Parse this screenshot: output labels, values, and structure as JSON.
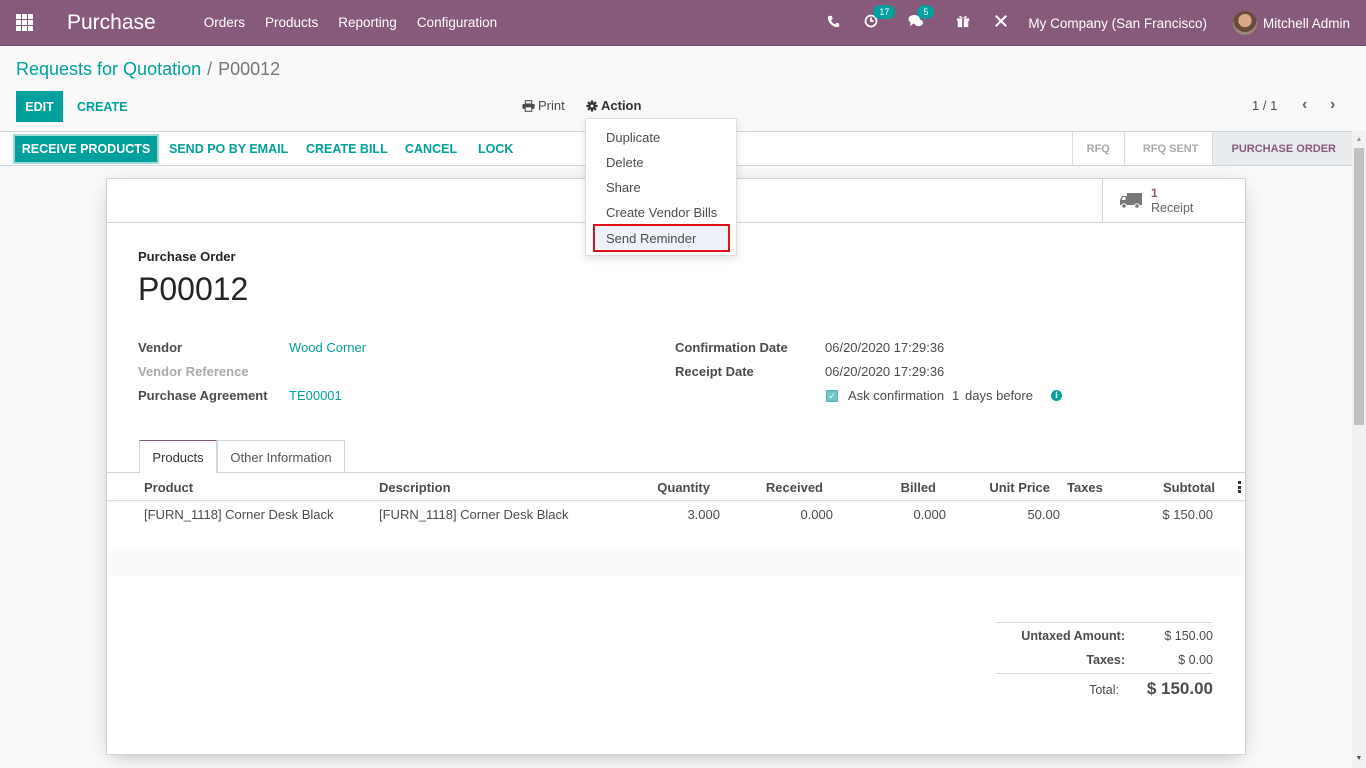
{
  "navbar": {
    "app_name": "Purchase",
    "menu": [
      "Orders",
      "Products",
      "Reporting",
      "Configuration"
    ],
    "icons": {
      "apps": "apps-grid-icon",
      "phone": "phone-icon",
      "activity": "clock-icon",
      "messaging": "chat-icon",
      "gift": "gift-icon",
      "debug": "tools-icon"
    },
    "activity_count": "17",
    "message_count": "5",
    "company": "My Company (San Francisco)",
    "user": "Mitchell Admin"
  },
  "breadcrumb": {
    "parent": "Requests for Quotation",
    "separator": "/",
    "current": "P00012"
  },
  "control": {
    "edit_label": "EDIT",
    "create_label": "CREATE",
    "print_label": "Print",
    "action_label": "Action",
    "pager": "1 / 1"
  },
  "action_menu": {
    "items": [
      "Duplicate",
      "Delete",
      "Share",
      "Create Vendor Bills",
      "Send Reminder"
    ],
    "highlighted": "Send Reminder"
  },
  "statusbar": {
    "buttons": [
      "RECEIVE PRODUCTS",
      "SEND PO BY EMAIL",
      "CREATE BILL",
      "CANCEL",
      "LOCK"
    ],
    "stages": [
      "RFQ",
      "RFQ SENT",
      "PURCHASE ORDER"
    ],
    "active_stage": "PURCHASE ORDER"
  },
  "smart_button": {
    "count": "1",
    "label": "Receipt"
  },
  "form": {
    "title_label": "Purchase Order",
    "title": "P00012",
    "vendor_label": "Vendor",
    "vendor": "Wood Corner",
    "vendor_ref_label": "Vendor Reference",
    "vendor_ref": "",
    "agreement_label": "Purchase Agreement",
    "agreement": "TE00001",
    "confirmation_date_label": "Confirmation Date",
    "confirmation_date": "06/20/2020 17:29:36",
    "receipt_date_label": "Receipt Date",
    "receipt_date": "06/20/2020 17:29:36",
    "ask_confirmation_checked": true,
    "ask_confirmation_prefix": "Ask confirmation",
    "ask_confirmation_days": "1",
    "ask_confirmation_suffix": "days before"
  },
  "tabs": [
    "Products",
    "Other Information"
  ],
  "order_lines": {
    "columns": [
      "Product",
      "Description",
      "Quantity",
      "Received",
      "Billed",
      "Unit Price",
      "Taxes",
      "Subtotal"
    ],
    "rows": [
      {
        "product": "[FURN_1118] Corner Desk Black",
        "description": "[FURN_1118] Corner Desk Black",
        "quantity": "3.000",
        "received": "0.000",
        "billed": "0.000",
        "unit_price": "50.00",
        "taxes": "",
        "subtotal": "$ 150.00"
      }
    ]
  },
  "totals": {
    "untaxed_label": "Untaxed Amount:",
    "untaxed": "$ 150.00",
    "taxes_label": "Taxes:",
    "taxes": "$ 0.00",
    "total_label": "Total:",
    "total": "$ 150.00"
  },
  "colors": {
    "brand": "#875a7b",
    "accent": "#00a09d",
    "highlight_outline": "#e2101a"
  }
}
